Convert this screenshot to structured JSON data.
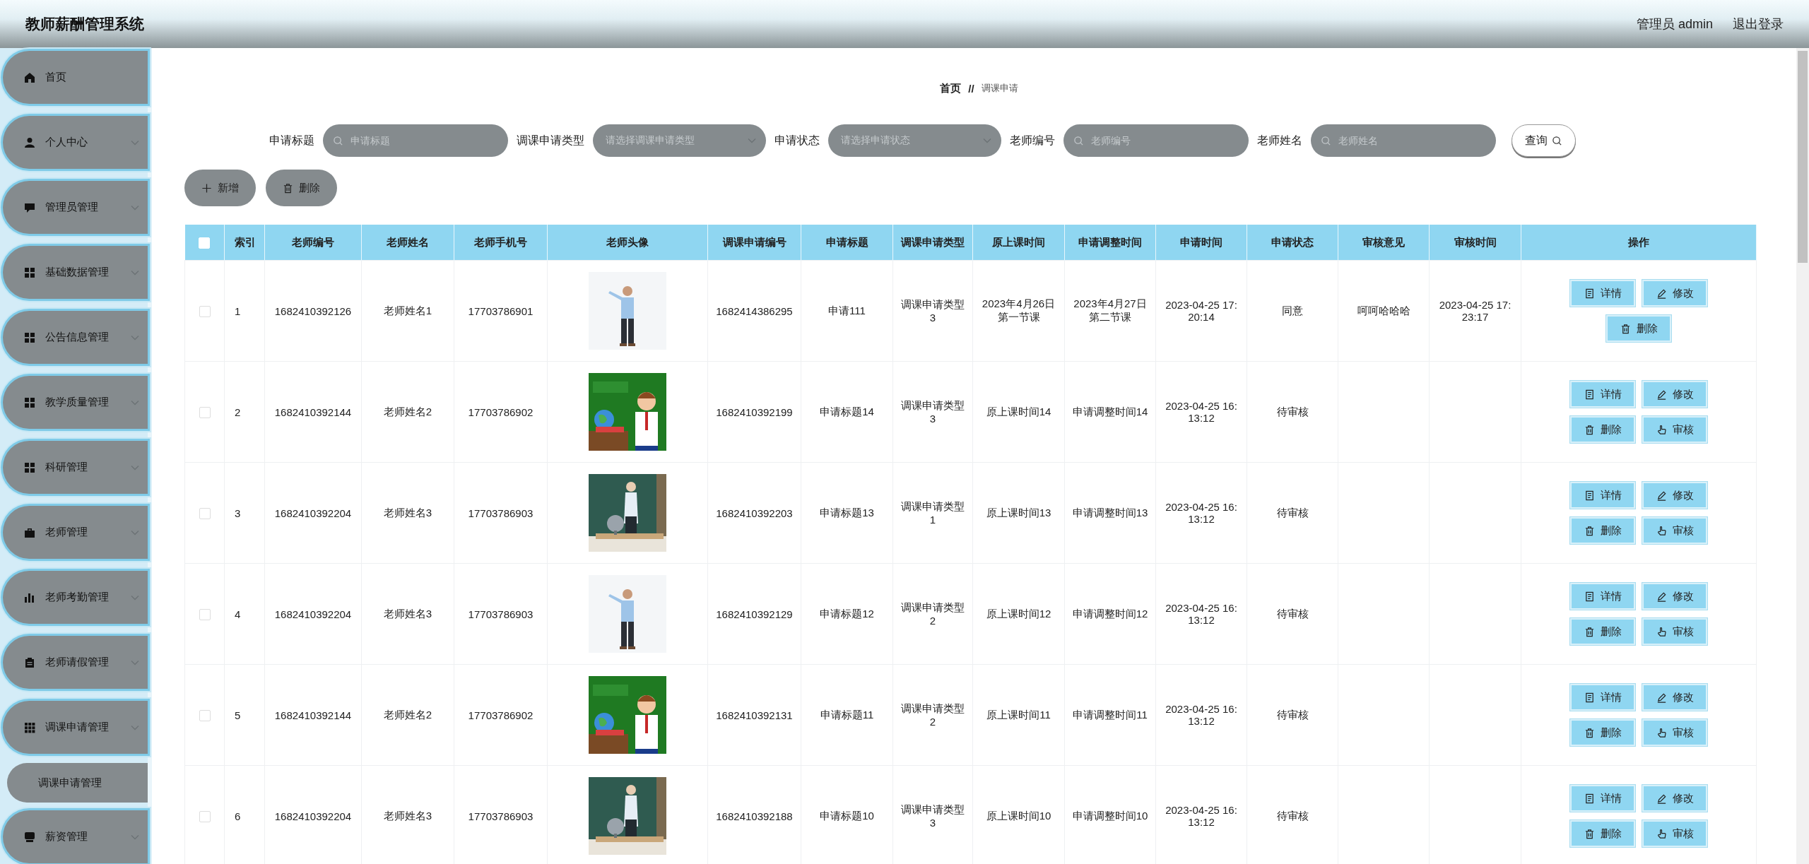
{
  "header": {
    "title": "教师薪酬管理系统",
    "user": "管理员 admin",
    "logout": "退出登录"
  },
  "sidebar": {
    "items": [
      {
        "label": "首页",
        "kind": "link"
      },
      {
        "label": "个人中心",
        "kind": "menu"
      },
      {
        "label": "管理员管理",
        "kind": "menu"
      },
      {
        "label": "基础数据管理",
        "kind": "menu"
      },
      {
        "label": "公告信息管理",
        "kind": "menu"
      },
      {
        "label": "教学质量管理",
        "kind": "menu"
      },
      {
        "label": "科研管理",
        "kind": "menu"
      },
      {
        "label": "老师管理",
        "kind": "menu"
      },
      {
        "label": "老师考勤管理",
        "kind": "menu"
      },
      {
        "label": "老师请假管理",
        "kind": "menu"
      },
      {
        "label": "调课申请管理",
        "kind": "menu",
        "children": [
          {
            "label": "调课申请管理"
          }
        ]
      },
      {
        "label": "薪资管理",
        "kind": "menu"
      }
    ]
  },
  "breadcrumb": {
    "home": "首页",
    "separator": "//",
    "current": "调课申请"
  },
  "filters": [
    {
      "label": "申请标题",
      "kind": "input",
      "placeholder": "申请标题"
    },
    {
      "label": "调课申请类型",
      "kind": "select",
      "placeholder": "请选择调课申请类型"
    },
    {
      "label": "申请状态",
      "kind": "select",
      "placeholder": "请选择申请状态"
    },
    {
      "label": "老师编号",
      "kind": "input",
      "placeholder": "老师编号"
    },
    {
      "label": "老师姓名",
      "kind": "input",
      "placeholder": "老师姓名"
    }
  ],
  "search_button": "查询",
  "toolbar": [
    {
      "label": "新增",
      "kind": "add"
    },
    {
      "label": "删除",
      "kind": "delete"
    }
  ],
  "table": {
    "select_all_checked": false,
    "columns": [
      "索引",
      "老师编号",
      "老师姓名",
      "老师手机号",
      "老师头像",
      "调课申请编号",
      "申请标题",
      "调课申请类型",
      "原上课时间",
      "申请调整时间",
      "申请时间",
      "申请状态",
      "审核意见",
      "审核时间",
      "操作"
    ],
    "rows": [
      {
        "checked": false,
        "cells": [
          "1",
          "1682410392126",
          "老师姓名1",
          "17703786901",
          {
            "kind": "picture"
          },
          "1682414386295",
          "申请111",
          "调课申请类型3",
          "2023年4月26日第一节课",
          "2023年4月27日第二节课",
          "2023-04-25 17:20:14",
          "同意",
          "呵呵哈哈哈",
          "2023-04-25 17:23:17"
        ],
        "actions": [
          {
            "label": "详情",
            "kind": "detail"
          },
          {
            "label": "修改",
            "kind": "edit"
          },
          {
            "label": "删除",
            "kind": "delete"
          }
        ]
      },
      {
        "checked": false,
        "cells": [
          "2",
          "1682410392144",
          "老师姓名2",
          "17703786902",
          {
            "kind": "picture"
          },
          "1682410392199",
          "申请标题14",
          "调课申请类型3",
          "原上课时间14",
          "申请调整时间14",
          "2023-04-25 16:13:12",
          "待审核"
        ],
        "actions": [
          {
            "label": "详情",
            "kind": "detail"
          },
          {
            "label": "修改",
            "kind": "edit"
          },
          {
            "label": "删除",
            "kind": "delete"
          },
          {
            "label": "审核",
            "kind": "review"
          }
        ]
      },
      {
        "checked": false,
        "cells": [
          "3",
          "1682410392204",
          "老师姓名3",
          "17703786903",
          {
            "kind": "picture"
          },
          "1682410392203",
          "申请标题13",
          "调课申请类型1",
          "原上课时间13",
          "申请调整时间13",
          "2023-04-25 16:13:12",
          "待审核"
        ],
        "actions": [
          {
            "label": "详情",
            "kind": "detail"
          },
          {
            "label": "修改",
            "kind": "edit"
          },
          {
            "label": "删除",
            "kind": "delete"
          },
          {
            "label": "审核",
            "kind": "review"
          }
        ]
      },
      {
        "checked": false,
        "cells": [
          "4",
          "1682410392204",
          "老师姓名3",
          "17703786903",
          {
            "kind": "picture"
          },
          "1682410392129",
          "申请标题12",
          "调课申请类型2",
          "原上课时间12",
          "申请调整时间12",
          "2023-04-25 16:13:12",
          "待审核"
        ],
        "actions": [
          {
            "label": "详情",
            "kind": "detail"
          },
          {
            "label": "修改",
            "kind": "edit"
          },
          {
            "label": "删除",
            "kind": "delete"
          },
          {
            "label": "审核",
            "kind": "review"
          }
        ]
      },
      {
        "checked": false,
        "cells": [
          "5",
          "1682410392144",
          "老师姓名2",
          "17703786902",
          {
            "kind": "picture"
          },
          "1682410392131",
          "申请标题11",
          "调课申请类型2",
          "原上课时间11",
          "申请调整时间11",
          "2023-04-25 16:13:12",
          "待审核"
        ],
        "actions": [
          {
            "label": "详情",
            "kind": "detail"
          },
          {
            "label": "修改",
            "kind": "edit"
          },
          {
            "label": "删除",
            "kind": "delete"
          },
          {
            "label": "审核",
            "kind": "review"
          }
        ]
      },
      {
        "checked": false,
        "cells": [
          "6",
          "1682410392204",
          "老师姓名3",
          "17703786903",
          {
            "kind": "picture"
          },
          "1682410392188",
          "申请标题10",
          "调课申请类型3",
          "原上课时间10",
          "申请调整时间10",
          "2023-04-25 16:13:12",
          "待审核"
        ],
        "actions": [
          {
            "label": "详情",
            "kind": "detail"
          },
          {
            "label": "修改",
            "kind": "edit"
          },
          {
            "label": "删除",
            "kind": "delete"
          },
          {
            "label": "审核",
            "kind": "review"
          }
        ]
      }
    ]
  }
}
